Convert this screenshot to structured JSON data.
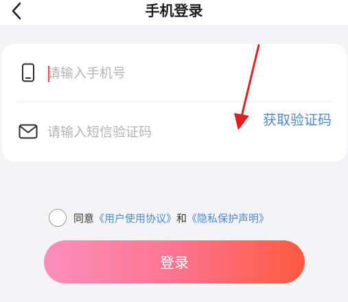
{
  "header": {
    "title": "手机登录",
    "back_icon": "chevron-left-icon"
  },
  "form": {
    "phone": {
      "icon": "smartphone-icon",
      "value": "",
      "placeholder": "请输入手机号"
    },
    "code": {
      "icon": "envelope-icon",
      "value": "",
      "placeholder": "请输入短信验证码",
      "get_code_label": "获取验证码"
    }
  },
  "agreement": {
    "checked": false,
    "prefix": "同意",
    "user_agreement": "《用户使用协议》",
    "conjunction": "和",
    "privacy_policy": "《隐私保护声明》"
  },
  "login_button": {
    "label": "登录"
  },
  "colors": {
    "accent_link": "#4a8ad2",
    "caret": "#f04a3c",
    "button_gradient_start": "#fb8ebc",
    "button_gradient_end": "#fd5a3e",
    "annotation_arrow": "#e02020"
  }
}
